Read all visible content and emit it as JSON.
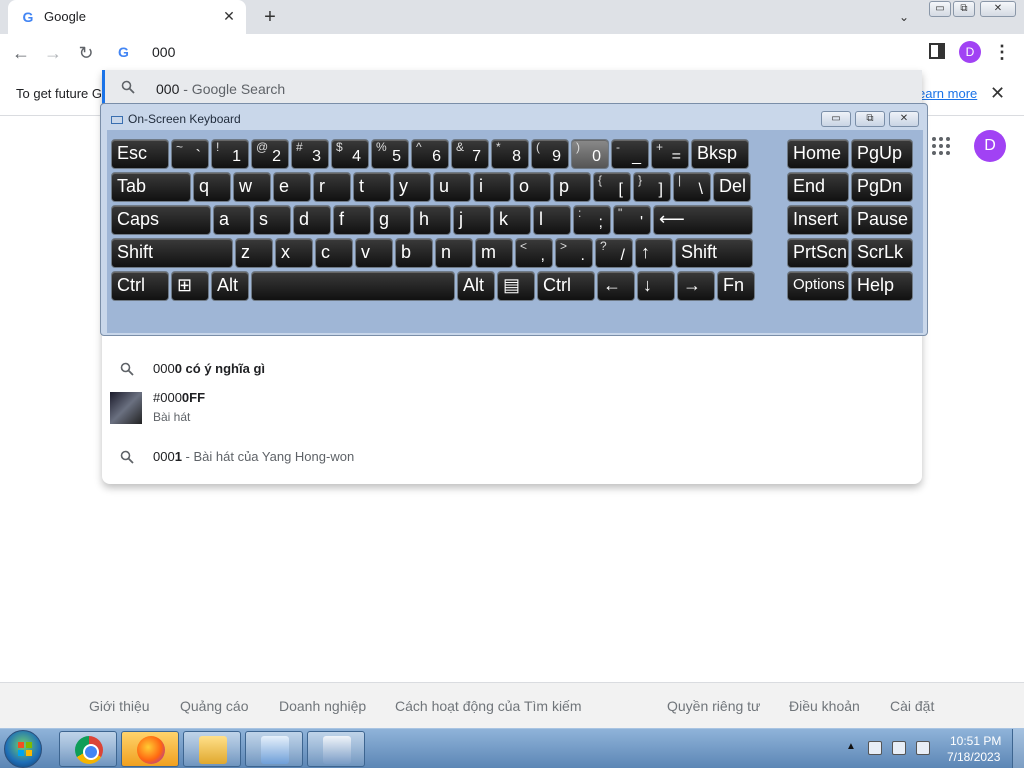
{
  "browser": {
    "tab_title": "Google",
    "tab_favicon": "G",
    "tab_close": "✕",
    "new_tab": "+",
    "tab_search": "⌄",
    "win_minimize": "▭",
    "win_restore": "⧉",
    "win_close": "✕"
  },
  "toolbar": {
    "back": "←",
    "forward": "→",
    "reload": "↻",
    "omnibox_value": "000",
    "profile_initial": "D",
    "menu": "⋮"
  },
  "infobar": {
    "text": "To get future G",
    "link": "earn more",
    "close": "✕"
  },
  "suggestions": {
    "first": {
      "query": "000",
      "suffix": " - Google Search"
    },
    "rows": [
      {
        "prefix": "000",
        "bold": "0 có ý nghĩa gì",
        "rest": ""
      },
      {
        "prefix": "#000",
        "bold": "0FF",
        "subtitle": "Bài hát"
      },
      {
        "prefix": "000",
        "bold": "1",
        "rest": " - Bài hát của Yang Hong-won"
      }
    ]
  },
  "page": {
    "profile_initial": "D"
  },
  "osk": {
    "title": "On-Screen Keyboard",
    "rows": [
      [
        {
          "label": "Esc"
        },
        {
          "up": "~",
          "lo": "`"
        },
        {
          "up": "!",
          "lo": "1"
        },
        {
          "up": "@",
          "lo": "2"
        },
        {
          "up": "#",
          "lo": "3"
        },
        {
          "up": "$",
          "lo": "4"
        },
        {
          "up": "%",
          "lo": "5"
        },
        {
          "up": "^",
          "lo": "6"
        },
        {
          "up": "&",
          "lo": "7"
        },
        {
          "up": "*",
          "lo": "8"
        },
        {
          "up": "(",
          "lo": "9"
        },
        {
          "up": ")",
          "lo": "0",
          "hot": true
        },
        {
          "up": "-",
          "lo": "_"
        },
        {
          "up": "+",
          "lo": "="
        },
        {
          "label": "Bksp"
        },
        {
          "label": "Home"
        },
        {
          "label": "PgUp"
        }
      ],
      [
        {
          "label": "Tab"
        },
        {
          "label": "q"
        },
        {
          "label": "w"
        },
        {
          "label": "e"
        },
        {
          "label": "r"
        },
        {
          "label": "t"
        },
        {
          "label": "y"
        },
        {
          "label": "u"
        },
        {
          "label": "i"
        },
        {
          "label": "o"
        },
        {
          "label": "p"
        },
        {
          "up": "{",
          "lo": "["
        },
        {
          "up": "}",
          "lo": "]"
        },
        {
          "up": "|",
          "lo": "\\"
        },
        {
          "label": "Del"
        },
        {
          "label": "End"
        },
        {
          "label": "PgDn"
        }
      ],
      [
        {
          "label": "Caps"
        },
        {
          "label": "a"
        },
        {
          "label": "s"
        },
        {
          "label": "d"
        },
        {
          "label": "f"
        },
        {
          "label": "g"
        },
        {
          "label": "h"
        },
        {
          "label": "j"
        },
        {
          "label": "k"
        },
        {
          "label": "l"
        },
        {
          "up": ":",
          "lo": ";"
        },
        {
          "up": "\"",
          "lo": "'"
        },
        {
          "label": "⟵"
        },
        {
          "label": "Insert"
        },
        {
          "label": "Pause"
        }
      ],
      [
        {
          "label": "Shift"
        },
        {
          "label": "z"
        },
        {
          "label": "x"
        },
        {
          "label": "c"
        },
        {
          "label": "v"
        },
        {
          "label": "b"
        },
        {
          "label": "n"
        },
        {
          "label": "m"
        },
        {
          "up": "<",
          "lo": ","
        },
        {
          "up": ">",
          "lo": "."
        },
        {
          "up": "?",
          "lo": "/"
        },
        {
          "label": "↑"
        },
        {
          "label": "Shift"
        },
        {
          "label": "PrtScn"
        },
        {
          "label": "ScrLk"
        }
      ],
      [
        {
          "label": "Ctrl"
        },
        {
          "label": "⊞"
        },
        {
          "label": "Alt"
        },
        {
          "label": ""
        },
        {
          "label": "Alt"
        },
        {
          "label": "▤"
        },
        {
          "label": "Ctrl"
        },
        {
          "label": "←"
        },
        {
          "label": "↓"
        },
        {
          "label": "→"
        },
        {
          "label": "Fn"
        },
        {
          "label": "Options"
        },
        {
          "label": "Help"
        }
      ]
    ]
  },
  "footer": {
    "left": [
      "Giới thiệu",
      "Quảng cáo",
      "Doanh nghiệp",
      "Cách hoạt động của Tìm kiếm"
    ],
    "right": [
      "Quyền riêng tư",
      "Điều khoản",
      "Cài đặt"
    ]
  },
  "taskbar": {
    "apps": [
      "chrome-icon",
      "firefox-icon",
      "folder-icon",
      "control-panel-icon",
      "keyboard-icon"
    ],
    "tray_arrow": "▲",
    "time": "10:51 PM",
    "date": "7/18/2023"
  }
}
